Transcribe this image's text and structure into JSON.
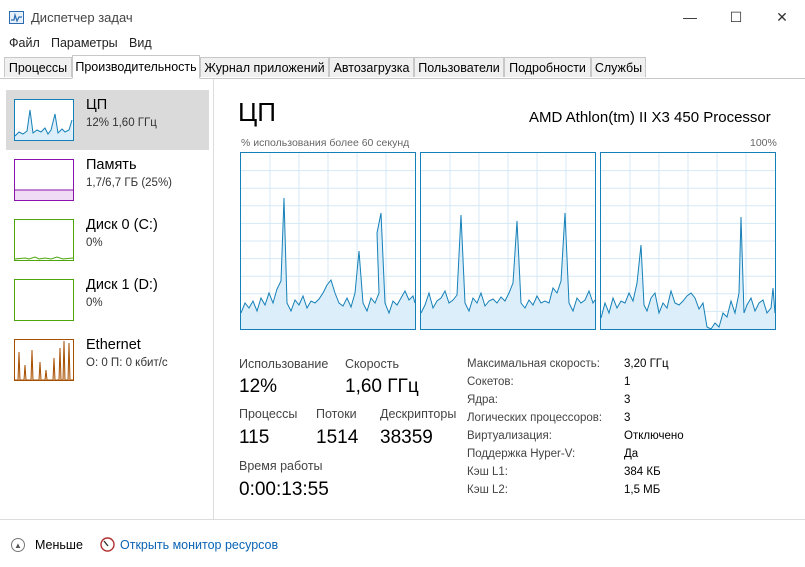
{
  "window": {
    "title": "Диспетчер задач",
    "minimize_glyph": "—",
    "maximize_glyph": "☐",
    "close_glyph": "✕"
  },
  "menu": [
    "Файл",
    "Параметры",
    "Вид"
  ],
  "tabs": [
    "Процессы",
    "Производительность",
    "Журнал приложений",
    "Автозагрузка",
    "Пользователи",
    "Подробности",
    "Службы"
  ],
  "active_tab": "Производительность",
  "sidebar": {
    "items": [
      {
        "name": "ЦП",
        "sub": "12% 1,60 ГГц",
        "color": "#1580b8",
        "selected": true,
        "icon": "cpu-graph-thumb"
      },
      {
        "name": "Память",
        "sub": "1,7/6,7 ГБ (25%)",
        "color": "#8b12ae",
        "selected": false,
        "icon": "memory-graph-thumb"
      },
      {
        "name": "Диск 0 (C:)",
        "sub": "0%",
        "color": "#4da60c",
        "selected": false,
        "icon": "disk-graph-thumb"
      },
      {
        "name": "Диск 1 (D:)",
        "sub": "0%",
        "color": "#4da60c",
        "selected": false,
        "icon": "disk-graph-thumb"
      },
      {
        "name": "Ethernet",
        "sub": "О: 0 П: 0 кбит/с",
        "color": "#a74f01",
        "selected": false,
        "icon": "ethernet-graph-thumb"
      }
    ]
  },
  "main": {
    "title": "ЦП",
    "processor": "AMD Athlon(tm) II X3 450 Processor",
    "graph_caption": "% использования более 60 секунд",
    "graph_max": "100%",
    "stats": {
      "usage_label": "Использование",
      "usage_value": "12%",
      "speed_label": "Скорость",
      "speed_value": "1,60 ГГц",
      "processes_label": "Процессы",
      "processes_value": "115",
      "threads_label": "Потоки",
      "threads_value": "1514",
      "handles_label": "Дескрипторы",
      "handles_value": "38359",
      "uptime_label": "Время работы",
      "uptime_value": "0:00:13:55"
    },
    "info": [
      {
        "label": "Максимальная скорость:",
        "value": "3,20 ГГц"
      },
      {
        "label": "Сокетов:",
        "value": "1"
      },
      {
        "label": "Ядра:",
        "value": "3"
      },
      {
        "label": "Логических процессоров:",
        "value": "3"
      },
      {
        "label": "Виртуализация:",
        "value": "Отключено"
      },
      {
        "label": "Поддержка Hyper-V:",
        "value": "Да"
      },
      {
        "label": "Кэш L1:",
        "value": "384 КБ"
      },
      {
        "label": "Кэш L2:",
        "value": "1,5 МБ"
      }
    ]
  },
  "footer": {
    "less_label": "Меньше",
    "resource_monitor_label": "Открыть монитор ресурсов"
  },
  "colors": {
    "cpu": "#1580b8",
    "cpu_fill": "#dbeef9",
    "grid": "#d4eaf5",
    "link": "#0a64b4"
  }
}
